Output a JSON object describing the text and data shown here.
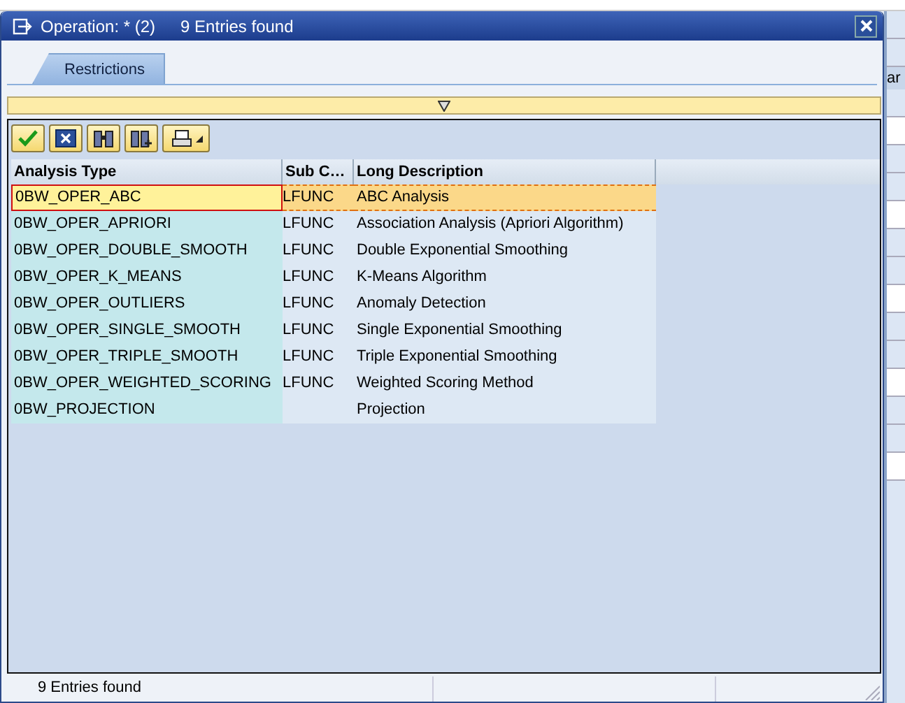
{
  "window": {
    "title": "Operation: * (2)",
    "subtitle": "9 Entries found"
  },
  "tabs": [
    {
      "label": "Restrictions",
      "selected": true
    }
  ],
  "table": {
    "columns": [
      "Analysis Type",
      "Sub C…",
      "Long Description"
    ],
    "rows": [
      {
        "cells": [
          "0BW_OPER_ABC",
          "LFUNC",
          "ABC Analysis"
        ],
        "selected": true
      },
      {
        "cells": [
          "0BW_OPER_APRIORI",
          "LFUNC",
          "Association Analysis (Apriori Algorithm)"
        ],
        "selected": false
      },
      {
        "cells": [
          "0BW_OPER_DOUBLE_SMOOTH",
          "LFUNC",
          "Double Exponential Smoothing"
        ],
        "selected": false
      },
      {
        "cells": [
          "0BW_OPER_K_MEANS",
          "LFUNC",
          "K-Means Algorithm"
        ],
        "selected": false
      },
      {
        "cells": [
          "0BW_OPER_OUTLIERS",
          "LFUNC",
          "Anomaly Detection"
        ],
        "selected": false
      },
      {
        "cells": [
          "0BW_OPER_SINGLE_SMOOTH",
          "LFUNC",
          "Single Exponential Smoothing"
        ],
        "selected": false
      },
      {
        "cells": [
          "0BW_OPER_TRIPLE_SMOOTH",
          "LFUNC",
          "Triple Exponential Smoothing"
        ],
        "selected": false
      },
      {
        "cells": [
          "0BW_OPER_WEIGHTED_SCORING",
          "LFUNC",
          "Weighted Scoring Method"
        ],
        "selected": false
      },
      {
        "cells": [
          "0BW_PROJECTION",
          "",
          "Projection"
        ],
        "selected": false
      }
    ]
  },
  "status_bar": "9 Entries found",
  "background": {
    "column_header": "ar"
  }
}
